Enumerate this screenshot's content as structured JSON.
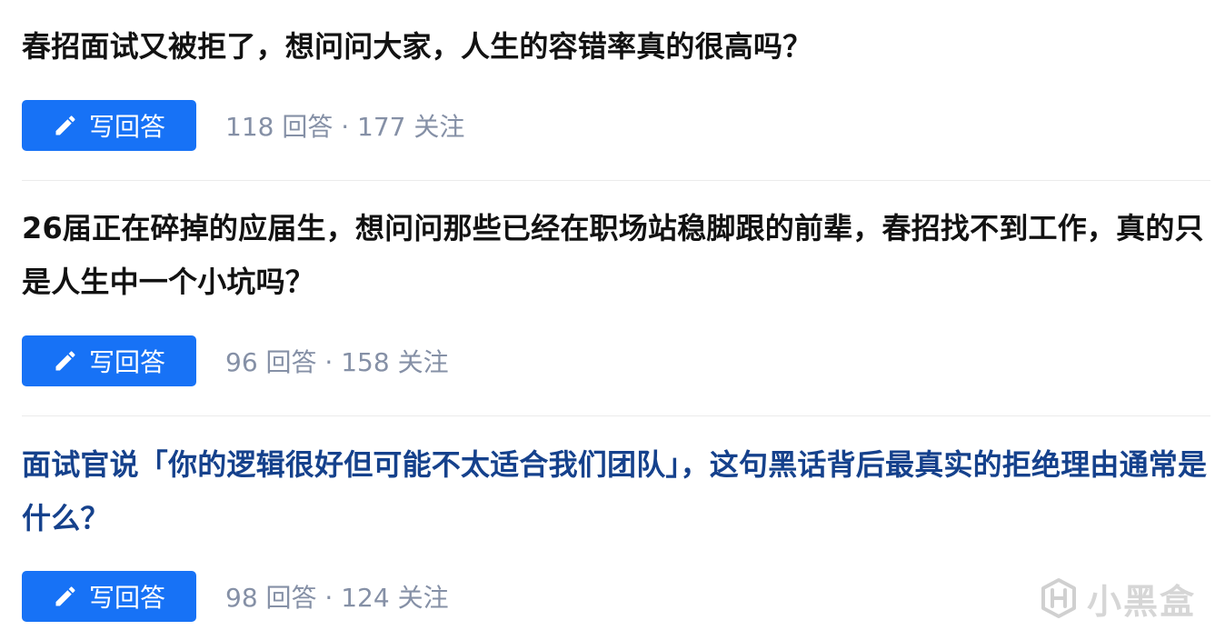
{
  "questions": [
    {
      "title": "春招面试又被拒了，想问问大家，人生的容错率真的很高吗？",
      "write_label": "写回答",
      "meta": "118 回答 · 177 关注"
    },
    {
      "title": "26届正在碎掉的应届生，想问问那些已经在职场站稳脚跟的前辈，春招找不到工作，真的只是人生中一个小坑吗？",
      "write_label": "写回答",
      "meta": "96 回答 · 158 关注"
    },
    {
      "title": "面试官说「你的逻辑很好但可能不太适合我们团队」，这句黑话背后最真实的拒绝理由通常是什么？",
      "write_label": "写回答",
      "meta": "98 回答 · 124 关注"
    }
  ],
  "watermark": {
    "text": "小黑盒",
    "icon": "heybox-logo-icon"
  },
  "colors": {
    "title": "#121212",
    "title_visited": "#15418c",
    "button_bg": "#1772f6",
    "meta": "#8590a6",
    "divider": "#ebebeb"
  }
}
